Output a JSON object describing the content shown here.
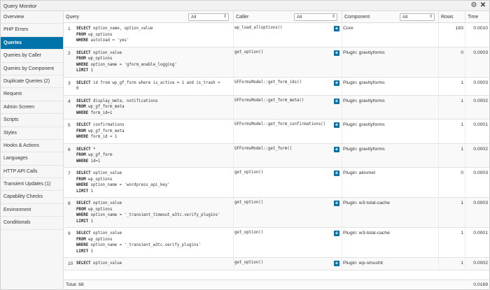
{
  "window": {
    "title": "Query Monitor",
    "gear_glyph": "⚙",
    "close_glyph": "✕"
  },
  "sidebar": {
    "items": [
      {
        "label": "Overview"
      },
      {
        "label": "PHP Errors"
      },
      {
        "label": "Queries",
        "active": true
      },
      {
        "label": "Queries by Caller"
      },
      {
        "label": "Queries by Component"
      },
      {
        "label": "Duplicate Queries (2)"
      },
      {
        "label": "Request"
      },
      {
        "label": "Admin Screen"
      },
      {
        "label": "Scripts"
      },
      {
        "label": "Styles"
      },
      {
        "label": "Hooks & Actions"
      },
      {
        "label": "Languages"
      },
      {
        "label": "HTTP API Calls"
      },
      {
        "label": "Transient Updates (1)"
      },
      {
        "label": "Capability Checks"
      },
      {
        "label": "Environment"
      },
      {
        "label": "Conditionals"
      }
    ]
  },
  "table": {
    "headers": {
      "query": "Query",
      "caller": "Caller",
      "component": "Component",
      "rows": "Rows",
      "time": "Time"
    },
    "filters": {
      "query": "All",
      "caller": "All",
      "component": "All"
    },
    "dropdown_arrow": "⇕",
    "plus_glyph": "+",
    "rows": [
      {
        "num": "1",
        "sql": [
          [
            "SELECT",
            " option_name, option_value"
          ],
          [
            "FROM",
            " wp_options"
          ],
          [
            "WHERE",
            " autoload = 'yes'"
          ]
        ],
        "caller": "wp_load_alloptions()",
        "component": "Core",
        "rows": "183",
        "time": "0.0010"
      },
      {
        "num": "2",
        "sql": [
          [
            "SELECT",
            " option_value"
          ],
          [
            "FROM",
            " wp_options"
          ],
          [
            "WHERE",
            " option_name = 'gform_enable_logging'"
          ],
          [
            "LIMIT",
            " 1"
          ]
        ],
        "caller": "get_option()",
        "component": "Plugin: gravityforms",
        "rows": "0",
        "time": "0.0003"
      },
      {
        "num": "3",
        "sql": [
          [
            "SELECT",
            " id from wp_gf_form where is_active = 1 and is_trash ="
          ],
          [
            "",
            "0"
          ]
        ],
        "caller": "GFFormsModel::get_form_ids()",
        "component": "Plugin: gravityforms",
        "rows": "1",
        "time": "0.0003"
      },
      {
        "num": "4",
        "sql": [
          [
            "SELECT",
            " display_meta, notifications"
          ],
          [
            "FROM",
            " wp_gf_form_meta"
          ],
          [
            "WHERE",
            " form_id=1"
          ]
        ],
        "caller": "GFFormsModel::get_form_meta()",
        "component": "Plugin: gravityforms",
        "rows": "1",
        "time": "0.0002"
      },
      {
        "num": "5",
        "sql": [
          [
            "SELECT",
            " confirmations"
          ],
          [
            "FROM",
            " wp_gf_form_meta"
          ],
          [
            "WHERE",
            " form_id = 1"
          ]
        ],
        "caller": "GFFormsModel::get_form_confirmations()",
        "component": "Plugin: gravityforms",
        "rows": "1",
        "time": "0.0001"
      },
      {
        "num": "6",
        "sql": [
          [
            "SELECT",
            " *"
          ],
          [
            "FROM",
            " wp_gf_form"
          ],
          [
            "WHERE",
            " id=1"
          ]
        ],
        "caller": "GFFormsModel::get_form()",
        "component": "Plugin: gravityforms",
        "rows": "1",
        "time": "0.0002"
      },
      {
        "num": "7",
        "sql": [
          [
            "SELECT",
            " option_value"
          ],
          [
            "FROM",
            " wp_options"
          ],
          [
            "WHERE",
            " option_name = 'wordpress_api_key'"
          ],
          [
            "LIMIT",
            " 1"
          ]
        ],
        "caller": "get_option()",
        "component": "Plugin: akismet",
        "rows": "0",
        "time": "0.0003"
      },
      {
        "num": "8",
        "sql": [
          [
            "SELECT",
            " option_value"
          ],
          [
            "FROM",
            " wp_options"
          ],
          [
            "WHERE",
            " option_name = '_transient_timeout_w3tc.verify_plugins'"
          ],
          [
            "LIMIT",
            " 1"
          ]
        ],
        "caller": "get_option()",
        "component": "Plugin: w3-total-cache",
        "rows": "1",
        "time": "0.0003"
      },
      {
        "num": "9",
        "sql": [
          [
            "SELECT",
            " option_value"
          ],
          [
            "FROM",
            " wp_options"
          ],
          [
            "WHERE",
            " option_name = '_transient_w3tc.verify_plugins'"
          ],
          [
            "LIMIT",
            " 1"
          ]
        ],
        "caller": "get_option()",
        "component": "Plugin: w3-total-cache",
        "rows": "1",
        "time": "0.0001"
      },
      {
        "num": "10",
        "sql": [
          [
            "SELECT",
            " option_value"
          ]
        ],
        "caller": "get_option()",
        "component": "Plugin: wp-smushit",
        "rows": "1",
        "time": "0.0002"
      }
    ]
  },
  "footer": {
    "total": "Total: 68",
    "total_time": "0.0169"
  }
}
